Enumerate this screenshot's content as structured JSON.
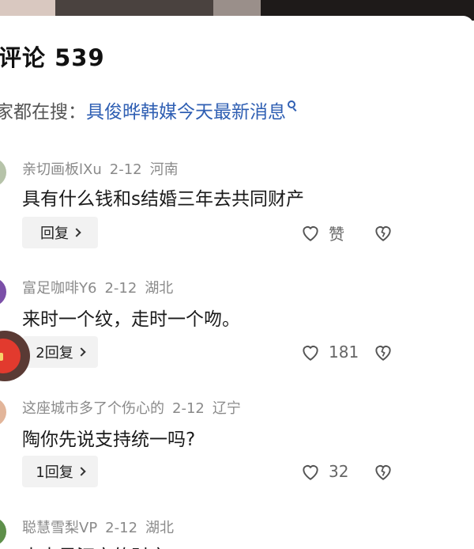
{
  "header": {
    "title": "评论 539"
  },
  "search_tip": {
    "prefix": "家都在搜：",
    "query": "具俊晔韩媒今天最新消息"
  },
  "comments": [
    {
      "user": "亲切画板lXu",
      "date": "2-12",
      "location": "河南",
      "text": "具有什么钱和s结婚三年去共同财产",
      "reply_label": "回复",
      "like_text": "赞",
      "avatar_color": "#b6c3a9"
    },
    {
      "user": "富足咖啡Y6",
      "date": "2-12",
      "location": "湖北",
      "text": "来时一个纹，走时一个吻。",
      "reply_label": "2回复",
      "like_text": "181",
      "avatar_color": "#7b4fa8"
    },
    {
      "user": "这座城市多了个伤心的",
      "date": "2-12",
      "location": "辽宁",
      "text": "陶你先说支持统一吗?",
      "reply_label": "1回复",
      "like_text": "32",
      "avatar_color": "#e2b59a"
    },
    {
      "user": "聪慧雪梨VP",
      "date": "2-12",
      "location": "湖北",
      "text": "本来是汪家的财产",
      "reply_label": "",
      "like_text": "",
      "avatar_color": "#5e8f4a"
    }
  ],
  "icons": {
    "like": "heart-outline-icon",
    "dislike": "broken-heart-icon",
    "reply": "chevron-right-icon",
    "search": "search-icon"
  },
  "colors": {
    "link": "#2f5fb3",
    "meta": "#8a8a8a",
    "reply_bg": "#f2f2f2"
  }
}
